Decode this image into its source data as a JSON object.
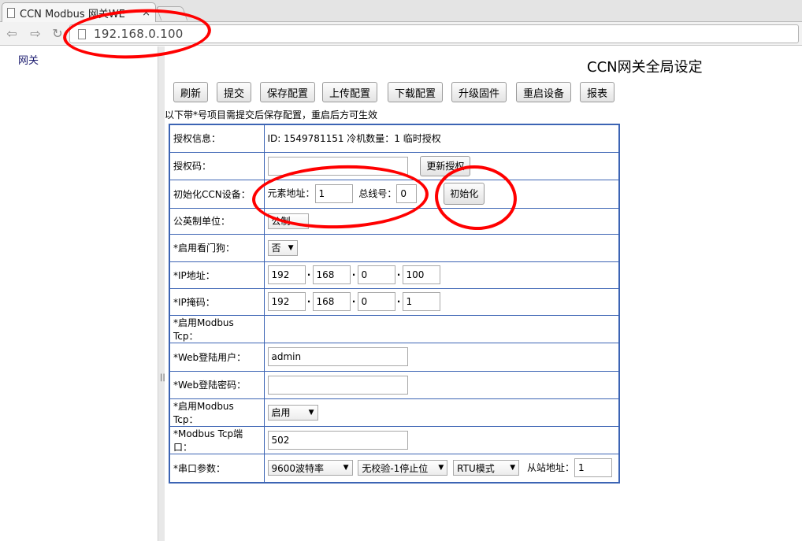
{
  "browser": {
    "tab_title": "CCN Modbus 网关WE",
    "tab_close": "×",
    "url": "192.168.0.100"
  },
  "sidebar": {
    "link": "网关"
  },
  "page": {
    "title": "CCN网关全局设定",
    "buttons": [
      "刷新",
      "提交",
      "保存配置",
      "上传配置",
      "下载配置",
      "升级固件",
      "重启设备",
      "报表"
    ],
    "note": "以下带*号项目需提交后保存配置，重启后方可生效"
  },
  "form": {
    "license_info": {
      "label": "授权信息：",
      "value": "ID: 1549781151 冷机数量：1 临时授权"
    },
    "license_code": {
      "label": "授权码：",
      "value": "",
      "button": "更新授权"
    },
    "init_ccn": {
      "label": "初始化CCN设备：",
      "elem_label": "元素地址：",
      "elem_value": "1",
      "bus_label": "总线号：",
      "bus_value": "0",
      "button": "初始化"
    },
    "units": {
      "label": "公英制单位：",
      "value": "公制"
    },
    "watchdog": {
      "label": "*启用看门狗：",
      "value": "否"
    },
    "ip": {
      "label": "*IP地址：",
      "octets": [
        "192",
        "168",
        "0",
        "100"
      ]
    },
    "mask": {
      "label": "*IP掩码：",
      "octets": [
        "192",
        "168",
        "0",
        "1"
      ]
    },
    "modbus_tcp_enable_1": {
      "label": "*启用Modbus Tcp："
    },
    "web_user": {
      "label": "*Web登陆用户：",
      "value": "admin"
    },
    "web_pass": {
      "label": "*Web登陆密码：",
      "value": ""
    },
    "modbus_tcp_enable_2": {
      "label": "*启用Modbus Tcp：",
      "value": "启用"
    },
    "modbus_port": {
      "label": "*Modbus Tcp端口：",
      "value": "502"
    },
    "serial": {
      "label": "*串口参数：",
      "baud": "9600波特率",
      "parity": "无校验-1停止位",
      "mode": "RTU模式",
      "slave_label": "从站地址：",
      "slave_value": "1"
    }
  },
  "colors": {
    "table_border": "#3c64b4",
    "annotation": "#ff0000"
  }
}
